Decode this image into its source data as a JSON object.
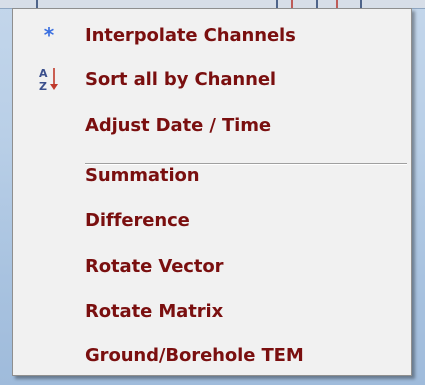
{
  "context_menu": {
    "items": [
      {
        "label": "Interpolate Channels",
        "icon": "asterisk-icon"
      },
      {
        "label": "Sort all by Channel",
        "icon": "sort-az-icon"
      },
      {
        "label": "Adjust Date / Time",
        "icon": null
      },
      {
        "label": "Summation",
        "icon": null
      },
      {
        "label": "Difference",
        "icon": null
      },
      {
        "label": "Rotate Vector",
        "icon": null
      },
      {
        "label": "Rotate Matrix",
        "icon": null
      },
      {
        "label": "Ground/Borehole TEM",
        "icon": null
      }
    ],
    "icon_glyphs": {
      "asterisk": "*",
      "sort_a": "A",
      "sort_z": "Z"
    }
  },
  "colors": {
    "menu_text": "#7a0f0f",
    "menu_background": "#f1f1f1",
    "asterisk_icon": "#3a6fe0",
    "sort_icon_letters": "#3b4f8c",
    "sort_icon_arrow": "#c0392b",
    "desktop_background": "#b9cfe7"
  }
}
